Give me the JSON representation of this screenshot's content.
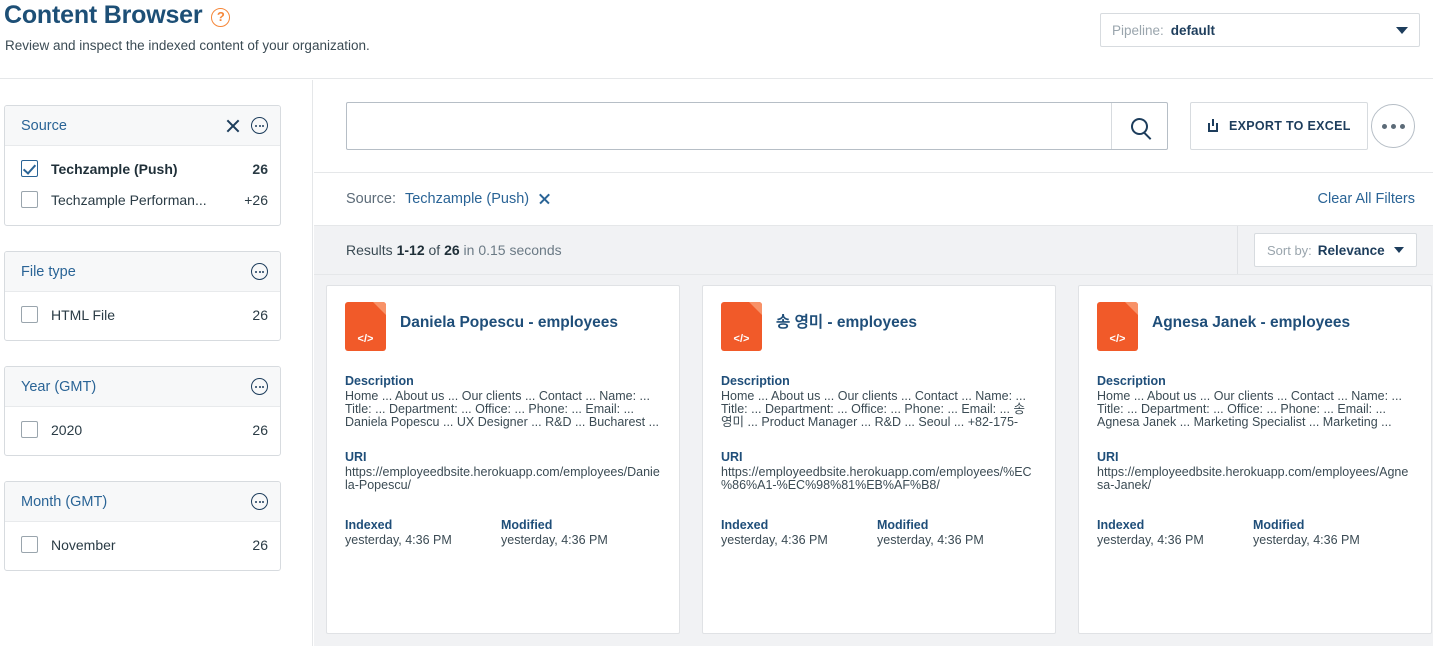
{
  "header": {
    "title": "Content Browser",
    "help_icon": "question-circle-icon",
    "subtitle": "Review and inspect the indexed content of your organization.",
    "pipeline": {
      "label": "Pipeline:",
      "value": "default"
    }
  },
  "facets": [
    {
      "title": "Source",
      "has_clear": true,
      "items": [
        {
          "label": "Techzample (Push)",
          "count": "26",
          "checked": true
        },
        {
          "label": "Techzample Performan...",
          "count": "+26",
          "checked": false
        }
      ]
    },
    {
      "title": "File type",
      "has_clear": false,
      "items": [
        {
          "label": "HTML File",
          "count": "26",
          "checked": false
        }
      ]
    },
    {
      "title": "Year (GMT)",
      "has_clear": false,
      "items": [
        {
          "label": "2020",
          "count": "26",
          "checked": false
        }
      ]
    },
    {
      "title": "Month (GMT)",
      "has_clear": false,
      "items": [
        {
          "label": "November",
          "count": "26",
          "checked": false
        }
      ]
    }
  ],
  "search": {
    "value": "",
    "placeholder": "",
    "search_icon": "magnifier-icon",
    "export_label": "EXPORT TO EXCEL",
    "export_icon": "download-icon",
    "more_icon": "ellipsis-icon"
  },
  "filters": {
    "source_label": "Source:",
    "source_value": "Techzample (Push)",
    "clear_all": "Clear All Filters"
  },
  "results": {
    "prefix": "Results",
    "range": "1-12",
    "of": "of",
    "total": "26",
    "suffix": "in 0.15 seconds",
    "sort_label": "Sort by:",
    "sort_value": "Relevance"
  },
  "labels": {
    "description": "Description",
    "uri": "URI",
    "indexed": "Indexed",
    "modified": "Modified"
  },
  "cards": [
    {
      "title": "Daniela Popescu - employees",
      "description": "Home ... About us ... Our clients ... Contact ... Name: ... Title: ... Department: ... Office: ... Phone: ... Email: ... Daniela Popescu ... UX Designer ... R&D ... Bucharest ...",
      "uri": "https://employeedbsite.herokuapp.com/employees/Daniela-Popescu/",
      "indexed": "yesterday, 4:36 PM",
      "modified": "yesterday, 4:36 PM",
      "file_icon": "html-file-icon"
    },
    {
      "title": "송 영미 - employees",
      "description": "Home ... About us ... Our clients ... Contact ... Name: ... Title: ... Department: ... Office: ... Phone: ... Email: ... 송 영미 ... Product Manager ... R&D ... Seoul ... +82-175-",
      "uri": "https://employeedbsite.herokuapp.com/employees/%EC%86%A1-%EC%98%81%EB%AF%B8/",
      "indexed": "yesterday, 4:36 PM",
      "modified": "yesterday, 4:36 PM",
      "file_icon": "html-file-icon"
    },
    {
      "title": "Agnesa Janek - employees",
      "description": "Home ... About us ... Our clients ... Contact ... Name: ... Title: ... Department: ... Office: ... Phone: ... Email: ... Agnesa Janek ... Marketing Specialist ... Marketing ...",
      "uri": "https://employeedbsite.herokuapp.com/employees/Agnesa-Janek/",
      "indexed": "yesterday, 4:36 PM",
      "modified": "yesterday, 4:36 PM",
      "file_icon": "html-file-icon"
    }
  ],
  "colors": {
    "brand_blue": "#1d4f76",
    "link_blue": "#2a6496",
    "accent_orange": "#f15a29",
    "panel_gray": "#f1f2f4"
  }
}
